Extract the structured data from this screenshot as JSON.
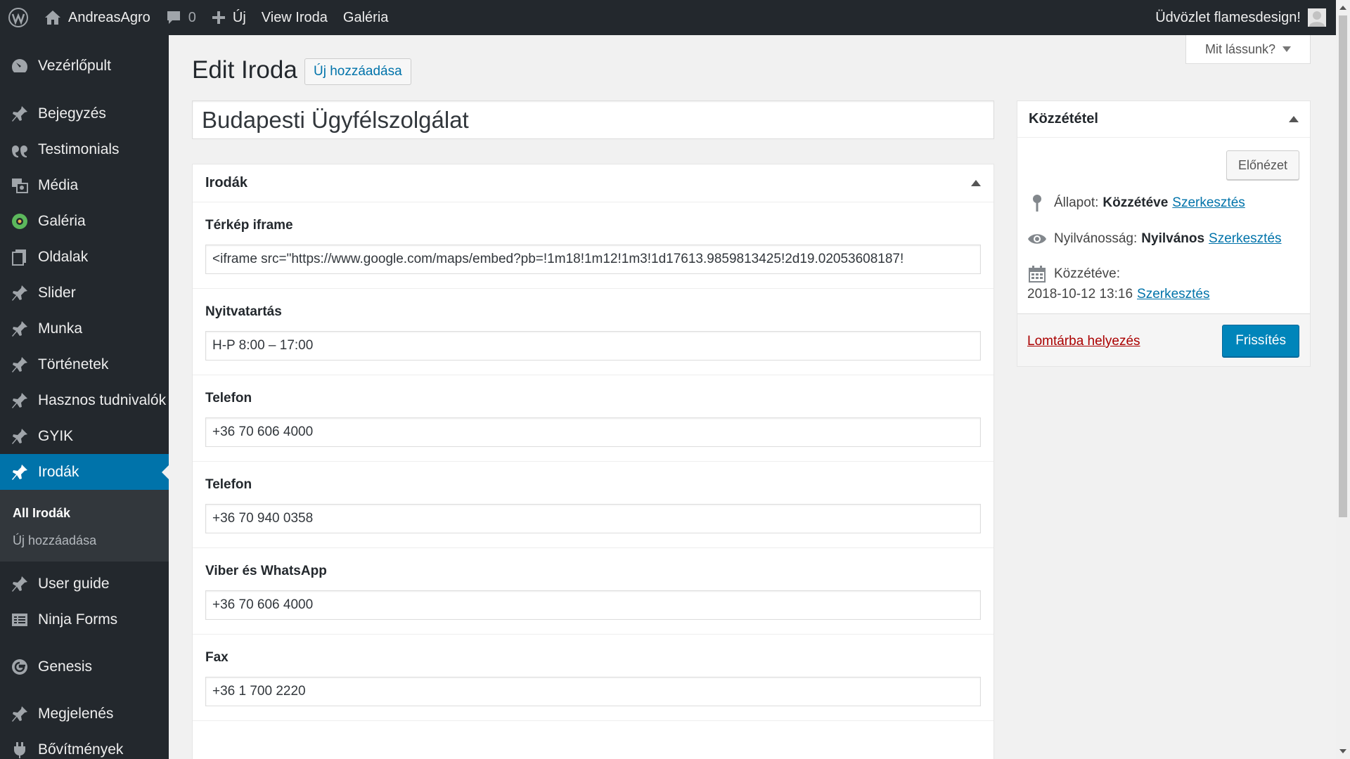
{
  "adminbar": {
    "site_name": "AndreasAgro",
    "comments_count": "0",
    "new_label": "Új",
    "view_label": "View Iroda",
    "gallery_label": "Galéria",
    "greeting": "Üdvözlet flamesdesign!"
  },
  "sidebar": {
    "items": [
      {
        "label": "Vezérlőpult",
        "icon": "dashboard-icon"
      },
      {
        "label": "Bejegyzés",
        "icon": "pin-icon"
      },
      {
        "label": "Testimonials",
        "icon": "quote-icon"
      },
      {
        "label": "Média",
        "icon": "media-icon"
      },
      {
        "label": "Galéria",
        "icon": "gallery-icon"
      },
      {
        "label": "Oldalak",
        "icon": "pages-icon"
      },
      {
        "label": "Slider",
        "icon": "pin-icon"
      },
      {
        "label": "Munka",
        "icon": "pin-icon"
      },
      {
        "label": "Történetek",
        "icon": "pin-icon"
      },
      {
        "label": "Hasznos tudnivalók",
        "icon": "pin-icon"
      },
      {
        "label": "GYIK",
        "icon": "pin-icon"
      },
      {
        "label": "Irodák",
        "icon": "pin-icon"
      },
      {
        "label": "User guide",
        "icon": "pin-icon"
      },
      {
        "label": "Ninja Forms",
        "icon": "forms-icon"
      },
      {
        "label": "Genesis",
        "icon": "genesis-icon"
      },
      {
        "label": "Megjelenés",
        "icon": "brush-icon"
      },
      {
        "label": "Bővítmények",
        "icon": "plugin-icon"
      }
    ],
    "submenu": {
      "current": "All Irodák",
      "add_new": "Új hozzáadása"
    }
  },
  "screen_options": {
    "label": "Mit lássunk?"
  },
  "header": {
    "title": "Edit Iroda",
    "add_new": "Új hozzáadása"
  },
  "post": {
    "title_value": "Budapesti Ügyfélszolgálat"
  },
  "metabox": {
    "title": "Irodák",
    "fields": [
      {
        "label": "Térkép iframe",
        "value": "<iframe src=\"https://www.google.com/maps/embed?pb=!1m18!1m12!1m3!1d17613.9859813425!2d19.02053608187!"
      },
      {
        "label": "Nyitvatartás",
        "value": "H-P 8:00 – 17:00"
      },
      {
        "label": "Telefon",
        "value": "+36 70 606 4000"
      },
      {
        "label": "Telefon",
        "value": "+36 70 940 0358"
      },
      {
        "label": "Viber és WhatsApp",
        "value": "+36 70 606 4000"
      },
      {
        "label": "Fax",
        "value": "+36 1 700 2220"
      }
    ]
  },
  "publish": {
    "title": "Közzététel",
    "preview": "Előnézet",
    "status_label": "Állapot:",
    "status_value": "Közzétéve",
    "visibility_label": "Nyilvánosság:",
    "visibility_value": "Nyilvános",
    "published_label": "Közzétéve:",
    "published_date": "2018-10-12 13:16",
    "edit_link": "Szerkesztés",
    "trash": "Lomtárba helyezés",
    "update": "Frissítés"
  },
  "colors": {
    "admin_dark": "#23282d",
    "accent": "#0073aa",
    "primary_button": "#0085ba",
    "trash_red": "#a00"
  }
}
